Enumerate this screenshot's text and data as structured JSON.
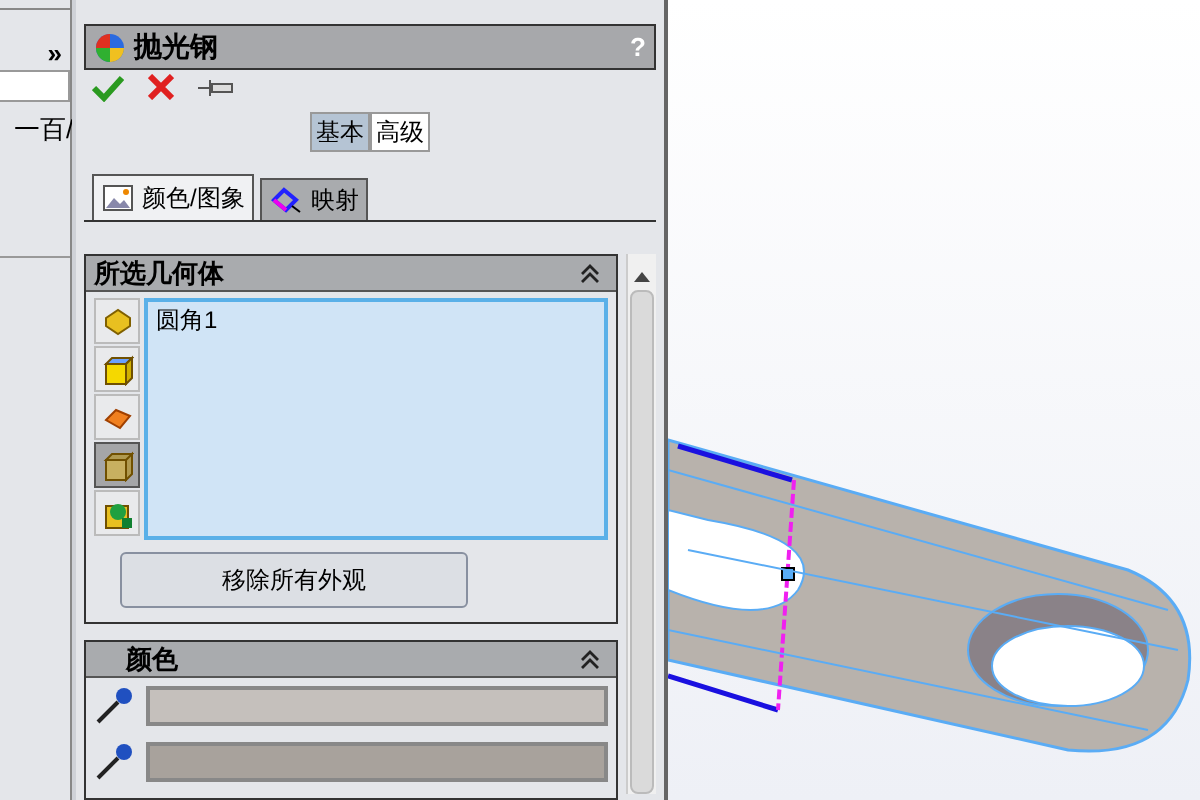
{
  "feature_tree": {
    "expand": "»",
    "item": "一百/"
  },
  "property_manager": {
    "title": "抛光钢",
    "help": "?",
    "modes": [
      {
        "label": "基本",
        "selected": true
      },
      {
        "label": "高级",
        "selected": false
      }
    ],
    "tabs": [
      {
        "label": "颜色/图象",
        "selected": true,
        "kind": "image"
      },
      {
        "label": "映射",
        "selected": false,
        "kind": "mapping"
      }
    ],
    "selected_geometry": {
      "title": "所选几何体",
      "filters": [
        {
          "kind": "part",
          "selected": false
        },
        {
          "kind": "body",
          "selected": false
        },
        {
          "kind": "face",
          "selected": false
        },
        {
          "kind": "feature",
          "selected": true
        },
        {
          "kind": "solid",
          "selected": false
        }
      ],
      "items": [
        "圆角1"
      ],
      "button": "移除所有外观"
    },
    "color": {
      "title": "颜色"
    }
  }
}
